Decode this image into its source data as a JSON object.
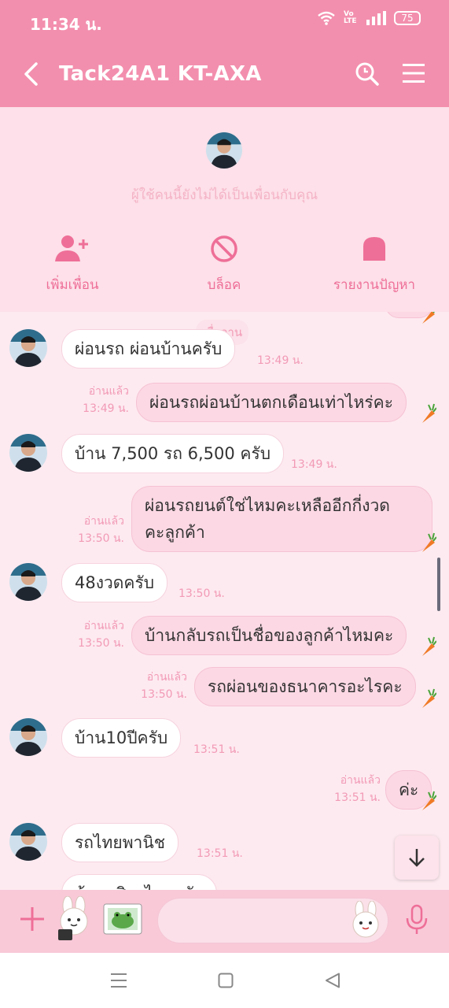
{
  "status": {
    "time": "11:34 น.",
    "volte": "Vo LTE",
    "battery": "75"
  },
  "header": {
    "title": "Tack24A1 KT-AXA"
  },
  "panel": {
    "notice": "ผู้ใช้คนนี้ยังไม่ได้เป็นเพื่อนกับคุณ",
    "actions": [
      {
        "label": "เพิ่มเพื่อน",
        "icon": "add-friend-icon"
      },
      {
        "label": "บล็อค",
        "icon": "block-icon"
      },
      {
        "label": "รายงานปัญหา",
        "icon": "report-icon"
      }
    ]
  },
  "chat": {
    "date": "เมื่อวาน",
    "read_label": "อ่านแล้ว",
    "messages": [
      {
        "dir": "in",
        "text": "ผ่อนรถ ผ่อนบ้านครับ",
        "time": "13:49 น."
      },
      {
        "dir": "out",
        "text": "ผ่อนรถผ่อนบ้านตกเดือนเท่าไหร่คะ",
        "time": "13:49 น."
      },
      {
        "dir": "in",
        "text": "บ้าน 7,500 รถ 6,500 ครับ",
        "time": "13:49 น."
      },
      {
        "dir": "out",
        "line1": "ผ่อนรถยนต์ใช่ไหมคะเหลืออีกกี่งวด",
        "line2": "คะลูกค้า",
        "time": "13:50 น."
      },
      {
        "dir": "in",
        "text": "48งวดครับ",
        "time": "13:50 น."
      },
      {
        "dir": "out",
        "text": "บ้านกลับรถเป็นชื่อของลูกค้าไหมคะ",
        "time": "13:50 น."
      },
      {
        "dir": "out",
        "text": "รถผ่อนของธนาคารอะไรคะ",
        "time": "13:50 น."
      },
      {
        "dir": "in",
        "text": "บ้าน10ปีครับ",
        "time": "13:51 น."
      },
      {
        "dir": "out",
        "text": "ค่ะ",
        "time": "13:51 น."
      },
      {
        "dir": "in",
        "text": "รถไทยพานิช",
        "time": "13:51 น."
      },
      {
        "dir": "in",
        "text": "บ้านกสิกรไทยครับ",
        "time": ""
      }
    ]
  },
  "colors": {
    "header": "#f38fae",
    "accent": "#ee6f98",
    "bubble_out": "#fcd8e4",
    "bubble_in": "#ffffff"
  }
}
